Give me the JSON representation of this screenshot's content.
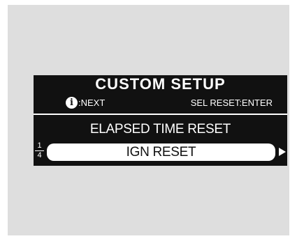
{
  "display": {
    "title": "CUSTOM SETUP",
    "info_icon_glyph": "i",
    "next_label": ":NEXT",
    "sel_reset_label": "SEL RESET:ENTER",
    "menu_item": "ELAPSED TIME RESET",
    "selected_option": "IGN RESET",
    "page_current": "1",
    "page_total": "4",
    "next_arrow": "right-arrow-icon"
  },
  "colors": {
    "screen_bg": "#111111",
    "text": "#ffffff",
    "frame_bg": "#dedede"
  }
}
